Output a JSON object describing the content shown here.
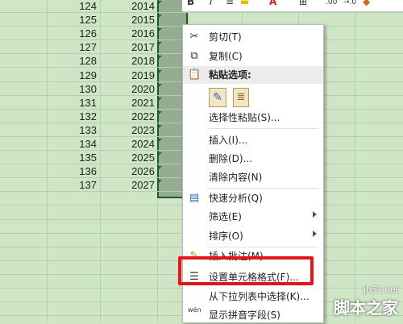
{
  "rows": [
    {
      "a": "124",
      "b": "2014"
    },
    {
      "a": "125",
      "b": "2015"
    },
    {
      "a": "126",
      "b": "2016"
    },
    {
      "a": "127",
      "b": "2017"
    },
    {
      "a": "128",
      "b": "2018"
    },
    {
      "a": "129",
      "b": "2019"
    },
    {
      "a": "130",
      "b": "2020"
    },
    {
      "a": "131",
      "b": "2021"
    },
    {
      "a": "132",
      "b": "2022"
    },
    {
      "a": "133",
      "b": "2023"
    },
    {
      "a": "134",
      "b": "2024"
    },
    {
      "a": "135",
      "b": "2025"
    },
    {
      "a": "136",
      "b": "2026"
    },
    {
      "a": "137",
      "b": "2027"
    }
  ],
  "ribbon": {
    "bold": "B",
    "italic": "I",
    "font_color": "A",
    "decimal_add": ".00",
    "decimal_remove": "→.0"
  },
  "menu": {
    "cut": "剪切(T)",
    "copy": "复制(C)",
    "paste_options": "粘贴选项:",
    "paste_special": "选择性粘贴(S)...",
    "insert": "插入(I)...",
    "delete": "删除(D)...",
    "clear": "清除内容(N)",
    "quick_analysis": "快速分析(Q)",
    "filter": "筛选(E)",
    "sort": "排序(O)",
    "insert_comment": "插入批注(M)",
    "format_cells": "设置单元格格式(F)...",
    "pick_from_list": "从下拉列表中选择(K)...",
    "phonetic": "显示拼音字段(S)"
  },
  "phonetic_icon_text": "wén",
  "watermark": {
    "site": "jb51.net",
    "brand": "脚本之家"
  },
  "colors": {
    "sheet_bg": "#cfe6c6",
    "selected": "#93ac92",
    "highlight": "#e5141b"
  }
}
